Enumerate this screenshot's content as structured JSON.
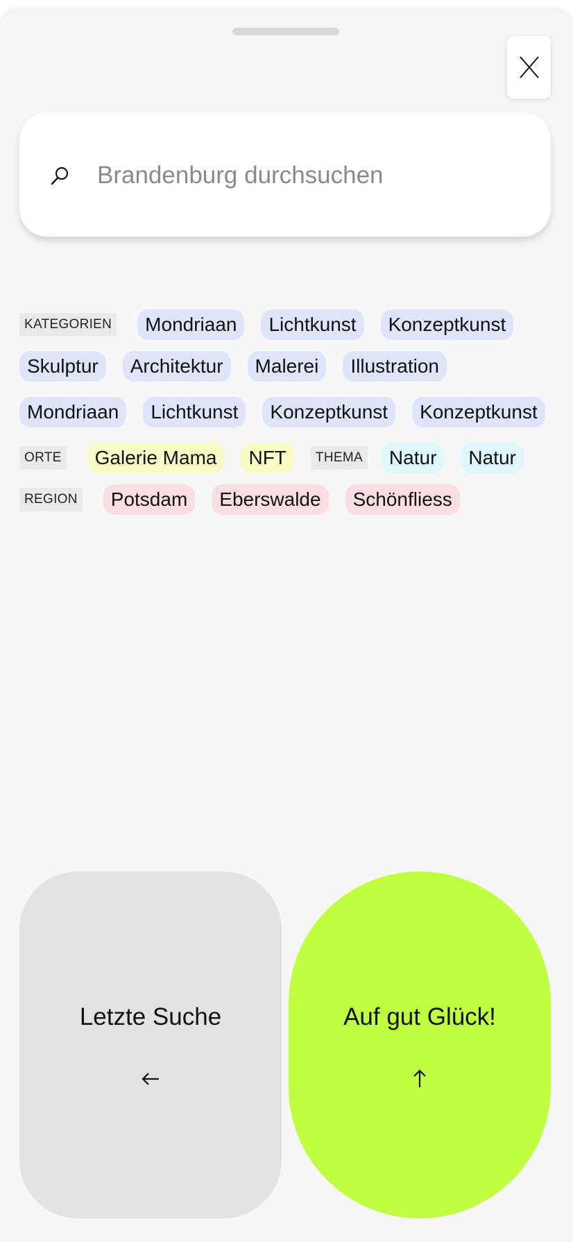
{
  "search": {
    "placeholder": "Brandenburg durchsuchen",
    "value": ""
  },
  "filters": {
    "kategorien": {
      "label": "KATEGORIEN",
      "chips": [
        "Mondriaan",
        "Lichtkunst",
        "Konzeptkunst",
        "Skulptur",
        "Architektur",
        "Malerei",
        "Illustration",
        "Mondriaan",
        "Lichtkunst",
        "Konzeptkunst",
        "Konzeptkunst"
      ]
    },
    "orte": {
      "label": "ORTE",
      "chips": [
        "Galerie Mama",
        "NFT"
      ]
    },
    "thema": {
      "label": "THEMA",
      "chips": [
        "Natur",
        "Natur"
      ]
    },
    "region": {
      "label": "REGION",
      "chips": [
        "Potsdam",
        "Eberswalde",
        "Schönfliess"
      ]
    }
  },
  "actions": {
    "last_search_label": "Letzte Suche",
    "lucky_label": "Auf gut Glück!"
  },
  "colors": {
    "sheet_background": "#f7f7f7",
    "category_chip": "#dfe5fb",
    "place_chip": "#f8fbc4",
    "theme_chip": "#dff8fb",
    "region_chip": "#fbdde5",
    "last_search_button": "#e3e3e3",
    "lucky_button": "#bfff40"
  },
  "icons": {
    "close": "close-icon",
    "search": "search-icon",
    "last_search_arrow": "arrow-left-icon",
    "lucky_arrow": "arrow-up-icon"
  }
}
